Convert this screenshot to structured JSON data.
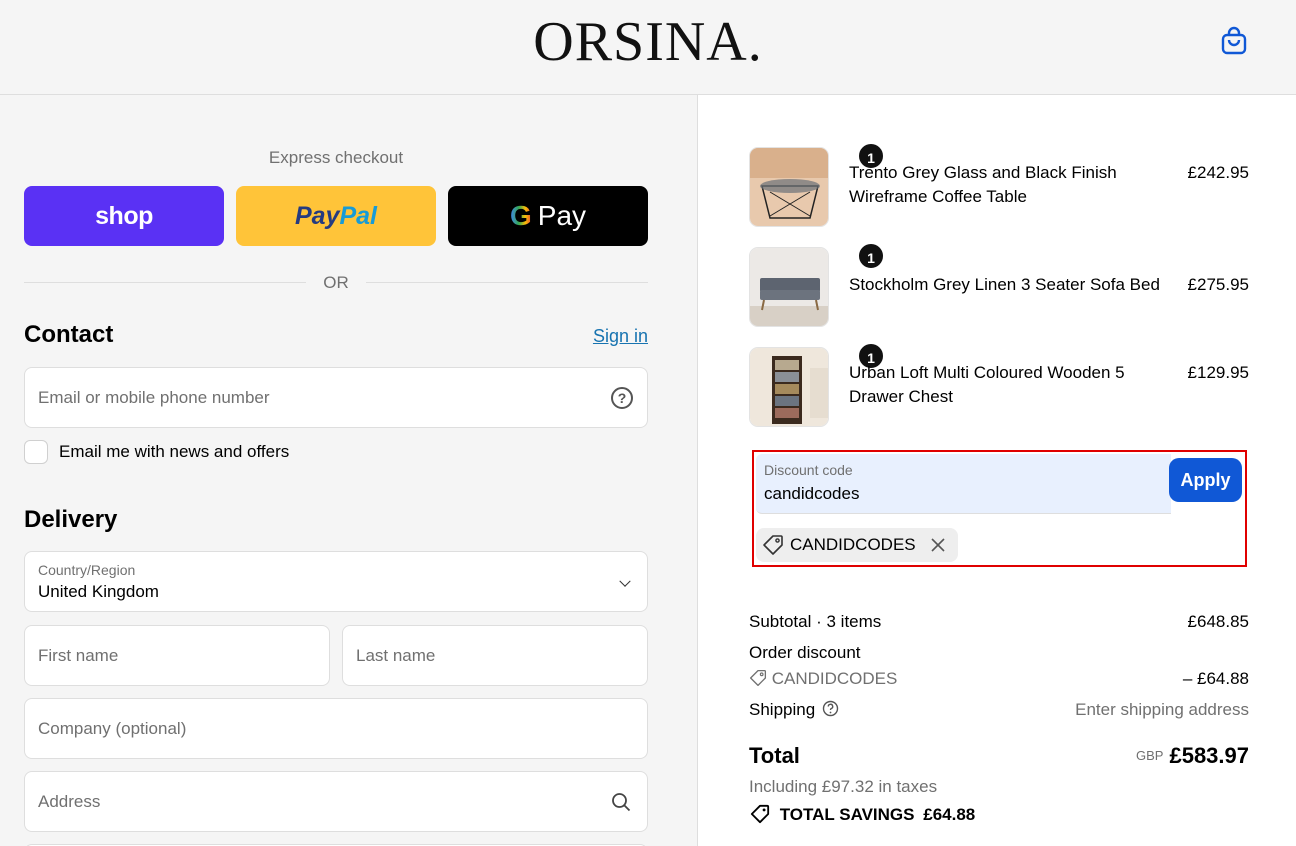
{
  "header": {
    "logo": "ORSINA."
  },
  "express": {
    "title": "Express checkout",
    "shop_label": "shop",
    "paypal_label_1": "Pay",
    "paypal_label_2": "Pal",
    "gpay_g": "G",
    "gpay_label": "Pay",
    "or_text": "OR"
  },
  "contact": {
    "title": "Contact",
    "signin": "Sign in",
    "email_placeholder": "Email or mobile phone number",
    "newsletter_label": "Email me with news and offers"
  },
  "delivery": {
    "title": "Delivery",
    "country_label": "Country/Region",
    "country_value": "United Kingdom",
    "first_name_placeholder": "First name",
    "last_name_placeholder": "Last name",
    "company_placeholder": "Company (optional)",
    "address_placeholder": "Address"
  },
  "cart": {
    "items": [
      {
        "name": "Trento Grey Glass and Black Finish Wireframe Coffee Table",
        "price": "£242.95",
        "qty": "1"
      },
      {
        "name": "Stockholm Grey Linen 3 Seater Sofa Bed",
        "price": "£275.95",
        "qty": "1"
      },
      {
        "name": "Urban Loft Multi Coloured Wooden 5 Drawer Chest",
        "price": "£129.95",
        "qty": "1"
      }
    ]
  },
  "discount": {
    "label": "Discount code",
    "value": "candidcodes",
    "apply_label": "Apply",
    "applied_code": "CANDIDCODES"
  },
  "summary": {
    "subtotal_label": "Subtotal · 3 items",
    "subtotal_value": "£648.85",
    "order_discount_label": "Order discount",
    "order_discount_code": "CANDIDCODES",
    "order_discount_value": "– £64.88",
    "shipping_label": "Shipping",
    "shipping_value": "Enter shipping address",
    "total_label": "Total",
    "currency": "GBP",
    "total_value": "£583.97",
    "tax_note": "Including £97.32 in taxes",
    "savings_label": "TOTAL SAVINGS",
    "savings_value": "£64.88"
  },
  "colors": {
    "shop": "#5a31f4",
    "paypal": "#ffc439",
    "gpay": "#000000",
    "apply": "#1058d6",
    "link": "#1773b0",
    "highlight": "#e00000"
  }
}
